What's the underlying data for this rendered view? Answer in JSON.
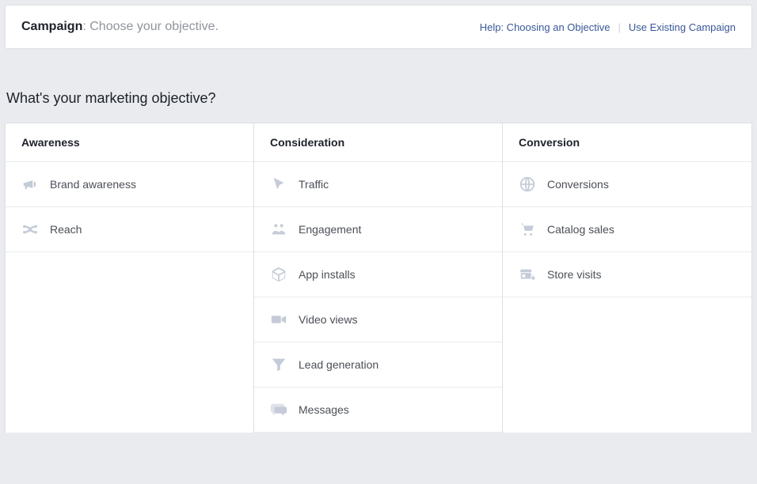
{
  "header": {
    "title_strong": "Campaign",
    "title_rest": ": Choose your objective.",
    "help_link": "Help: Choosing an Objective",
    "existing_link": "Use Existing Campaign"
  },
  "section_title": "What's your marketing objective?",
  "columns": [
    {
      "key": "awareness",
      "heading": "Awareness",
      "items": [
        {
          "icon": "megaphone-icon",
          "label": "Brand awareness"
        },
        {
          "icon": "reach-icon",
          "label": "Reach"
        }
      ]
    },
    {
      "key": "consideration",
      "heading": "Consideration",
      "items": [
        {
          "icon": "cursor-icon",
          "label": "Traffic"
        },
        {
          "icon": "engagement-icon",
          "label": "Engagement"
        },
        {
          "icon": "box-icon",
          "label": "App installs"
        },
        {
          "icon": "video-icon",
          "label": "Video views"
        },
        {
          "icon": "funnel-icon",
          "label": "Lead generation"
        },
        {
          "icon": "messages-icon",
          "label": "Messages"
        }
      ]
    },
    {
      "key": "conversion",
      "heading": "Conversion",
      "items": [
        {
          "icon": "globe-icon",
          "label": "Conversions"
        },
        {
          "icon": "cart-icon",
          "label": "Catalog sales"
        },
        {
          "icon": "store-icon",
          "label": "Store visits"
        }
      ]
    }
  ]
}
